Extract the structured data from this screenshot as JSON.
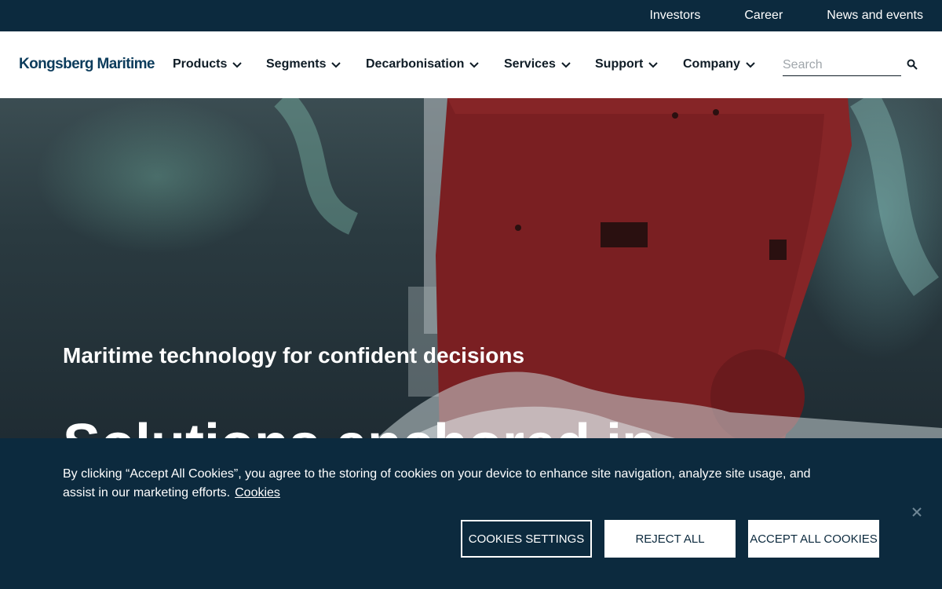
{
  "utility_nav": {
    "items": [
      {
        "label": "Investors"
      },
      {
        "label": "Career"
      },
      {
        "label": "News and events"
      }
    ]
  },
  "header": {
    "logo_text": "Kongsberg Maritime",
    "nav": [
      {
        "label": "Products"
      },
      {
        "label": "Segments"
      },
      {
        "label": "Decarbonisation"
      },
      {
        "label": "Services"
      },
      {
        "label": "Support"
      },
      {
        "label": "Company"
      }
    ],
    "search": {
      "placeholder": "Search",
      "value": ""
    }
  },
  "hero": {
    "subtitle": "Maritime technology for confident decisions",
    "title": "Solutions anchored in"
  },
  "cookie_banner": {
    "text": "By clicking “Accept All Cookies”, you agree to the storing of cookies on your device to enhance site navigation, analyze site usage, and assist in our marketing efforts.",
    "link_label": "Cookies",
    "buttons": {
      "settings": "COOKIES SETTINGS",
      "reject": "REJECT ALL",
      "accept": "ACCEPT ALL COOKIES"
    }
  },
  "colors": {
    "brand_dark": "#0c2a3e",
    "logo": "#0c3c5c",
    "ship_hull": "#7a1f22"
  },
  "icons": {
    "nav_chevron": "chevron-down-icon",
    "search": "search-icon",
    "close": "close-icon"
  }
}
